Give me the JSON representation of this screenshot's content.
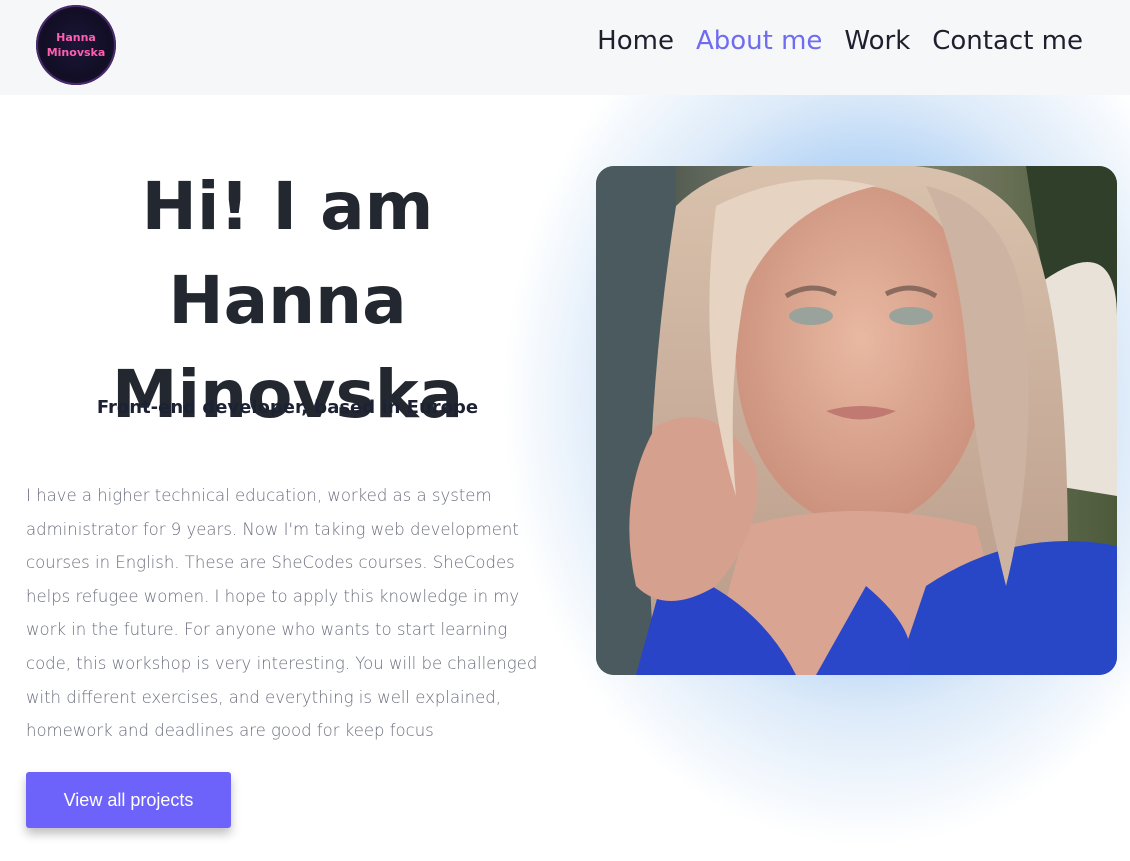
{
  "logo": {
    "line1": "Hanna",
    "line2": "Minovska"
  },
  "nav": {
    "home": "Home",
    "about": "About me",
    "work": "Work",
    "contact": "Contact me"
  },
  "hero": {
    "title_line1": "Hi! I am Hanna",
    "title_line2": "Minovska",
    "subtitle": "Front-end developer, based in Europe",
    "bio": "I have a higher technical education, worked as a system administrator for 9 years. Now I'm taking web development courses in English. These are SheCodes courses. SheCodes helps refugee women. I hope to apply this knowledge in my work in the future. For anyone who wants to start learning code, this workshop is very interesting. You will be challenged with different exercises, and everything is well explained, homework and deadlines are good for keep focus",
    "button_label": "View all projects"
  },
  "colors": {
    "accent": "#6d63fb",
    "active_nav": "#6f6cf0",
    "logo_text": "#ff5fae"
  }
}
